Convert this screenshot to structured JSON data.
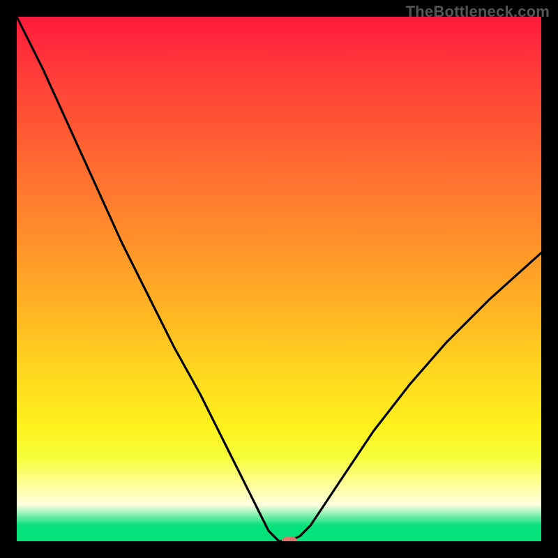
{
  "watermark": "TheBottleneck.com",
  "chart_data": {
    "type": "line",
    "title": "",
    "xlabel": "",
    "ylabel": "",
    "xlim": [
      0,
      100
    ],
    "ylim": [
      0,
      100
    ],
    "grid": false,
    "legend": false,
    "series": [
      {
        "name": "bottleneck-curve",
        "x": [
          0,
          5,
          10,
          15,
          20,
          25,
          30,
          35,
          40,
          45,
          48,
          50,
          52,
          54,
          56,
          58,
          62,
          68,
          75,
          82,
          90,
          100
        ],
        "values": [
          100,
          90,
          79,
          68,
          57,
          47,
          37,
          28,
          18,
          8,
          2,
          0,
          0,
          1,
          3,
          6,
          12,
          21,
          30,
          38,
          46,
          55
        ]
      }
    ],
    "gradient_stops": [
      {
        "pos": 0,
        "color": "#ff1a3c"
      },
      {
        "pos": 10,
        "color": "#ff3a3a"
      },
      {
        "pos": 22,
        "color": "#ff5a33"
      },
      {
        "pos": 34,
        "color": "#ff7a2e"
      },
      {
        "pos": 46,
        "color": "#ff9a28"
      },
      {
        "pos": 58,
        "color": "#ffba22"
      },
      {
        "pos": 68,
        "color": "#ffd81f"
      },
      {
        "pos": 78,
        "color": "#fff11d"
      },
      {
        "pos": 84,
        "color": "#f6ff3a"
      },
      {
        "pos": 90,
        "color": "#ffffa8"
      },
      {
        "pos": 93,
        "color": "#ffffe0"
      },
      {
        "pos": 97,
        "color": "#06e27a"
      },
      {
        "pos": 100,
        "color": "#06e27a"
      }
    ],
    "marker": {
      "x": 52,
      "y": 0,
      "color": "#e0746c"
    },
    "border_color": "#000000"
  }
}
